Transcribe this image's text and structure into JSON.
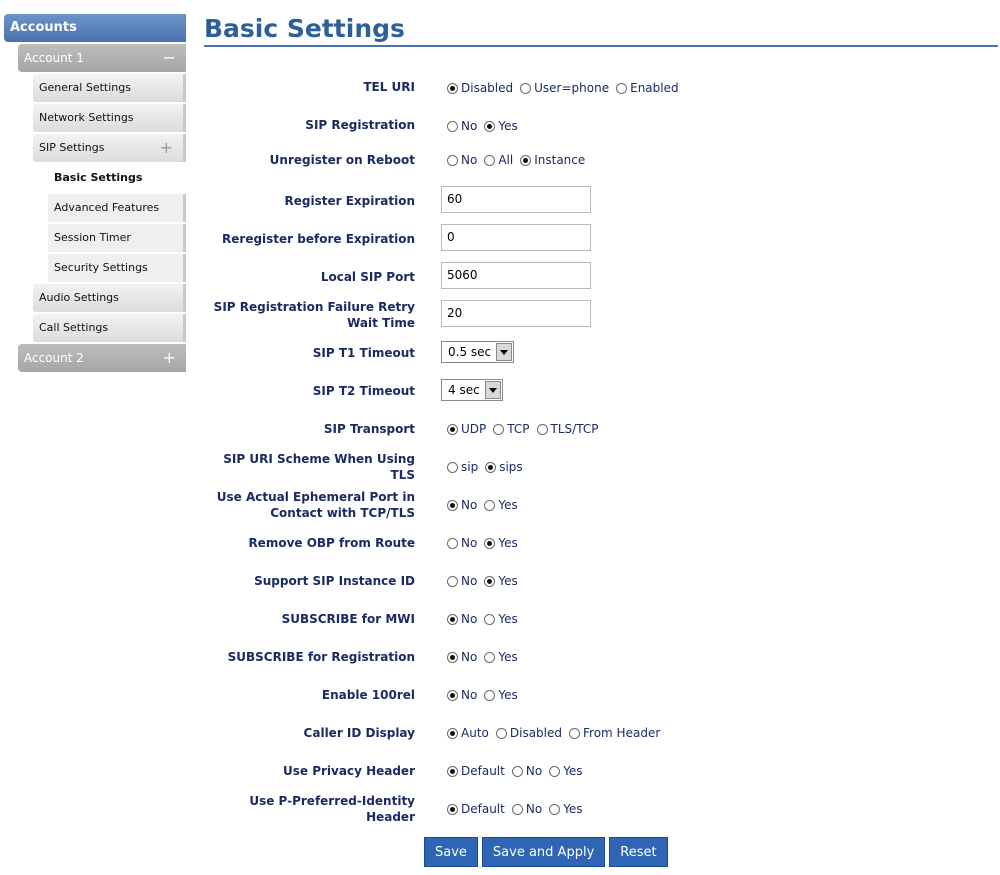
{
  "sidebar": {
    "accounts_label": "Accounts",
    "account1": {
      "label": "Account 1",
      "sign": "−"
    },
    "items": [
      {
        "label": "General Settings"
      },
      {
        "label": "Network Settings"
      },
      {
        "label": "SIP Settings",
        "sign": "+"
      }
    ],
    "sip_sub": [
      {
        "label": "Basic Settings",
        "active": true
      },
      {
        "label": "Advanced Features"
      },
      {
        "label": "Session Timer"
      },
      {
        "label": "Security Settings"
      }
    ],
    "items_after": [
      {
        "label": "Audio Settings"
      },
      {
        "label": "Call Settings"
      }
    ],
    "account2": {
      "label": "Account 2",
      "sign": "+"
    }
  },
  "page": {
    "title": "Basic Settings"
  },
  "fields": {
    "tel_uri": {
      "label": "TEL URI",
      "options": [
        "Disabled",
        "User=phone",
        "Enabled"
      ],
      "selected": "Disabled"
    },
    "sip_registration": {
      "label": "SIP Registration",
      "options": [
        "No",
        "Yes"
      ],
      "selected": "Yes"
    },
    "unregister_on_reboot": {
      "label": "Unregister on Reboot",
      "options": [
        "No",
        "All",
        "Instance"
      ],
      "selected": "Instance"
    },
    "register_expiration": {
      "label": "Register Expiration",
      "value": "60"
    },
    "reregister_before_expiration": {
      "label": "Reregister before Expiration",
      "value": "0"
    },
    "local_sip_port": {
      "label": "Local SIP Port",
      "value": "5060"
    },
    "failure_retry": {
      "label_line1": "SIP Registration Failure Retry",
      "label_line2": "Wait Time",
      "value": "20"
    },
    "sip_t1_timeout": {
      "label": "SIP T1 Timeout",
      "value": "0.5 sec"
    },
    "sip_t2_timeout": {
      "label": "SIP T2 Timeout",
      "value": "4 sec"
    },
    "sip_transport": {
      "label": "SIP Transport",
      "options": [
        "UDP",
        "TCP",
        "TLS/TCP"
      ],
      "selected": "UDP"
    },
    "sip_uri_scheme": {
      "label_line1": "SIP URI Scheme When Using",
      "label_line2": "TLS",
      "options": [
        "sip",
        "sips"
      ],
      "selected": "sips"
    },
    "ephemeral_port": {
      "label_line1": "Use Actual Ephemeral Port in",
      "label_line2": "Contact with TCP/TLS",
      "options": [
        "No",
        "Yes"
      ],
      "selected": "No"
    },
    "remove_obp": {
      "label": "Remove OBP from Route",
      "options": [
        "No",
        "Yes"
      ],
      "selected": "Yes"
    },
    "support_sip_instance": {
      "label": "Support SIP Instance ID",
      "options": [
        "No",
        "Yes"
      ],
      "selected": "Yes"
    },
    "subscribe_mwi": {
      "label": "SUBSCRIBE for MWI",
      "options": [
        "No",
        "Yes"
      ],
      "selected": "No"
    },
    "subscribe_registration": {
      "label": "SUBSCRIBE for Registration",
      "options": [
        "No",
        "Yes"
      ],
      "selected": "No"
    },
    "enable_100rel": {
      "label": "Enable 100rel",
      "options": [
        "No",
        "Yes"
      ],
      "selected": "No"
    },
    "caller_id_display": {
      "label": "Caller ID Display",
      "options": [
        "Auto",
        "Disabled",
        "From Header"
      ],
      "selected": "Auto"
    },
    "privacy_header": {
      "label": "Use Privacy Header",
      "options": [
        "Default",
        "No",
        "Yes"
      ],
      "selected": "Default"
    },
    "ppi_header": {
      "label_line1": "Use P-Preferred-Identity",
      "label_line2": "Header",
      "options": [
        "Default",
        "No",
        "Yes"
      ],
      "selected": "Default"
    }
  },
  "buttons": {
    "save": "Save",
    "save_apply": "Save and Apply",
    "reset": "Reset"
  }
}
